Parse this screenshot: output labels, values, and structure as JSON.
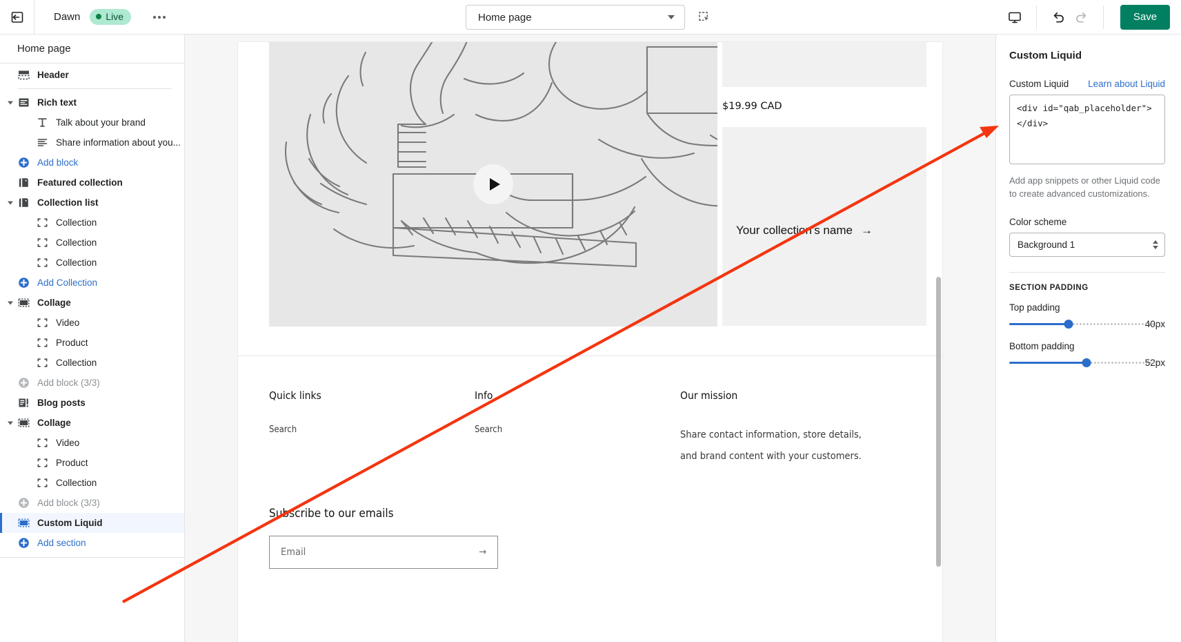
{
  "topbar": {
    "exit_icon": "exit-arrow-icon",
    "theme_name": "Dawn",
    "status_badge": "Live",
    "more_actions": "more-actions-icon",
    "page_selector_value": "Home page",
    "inspect_icon": "select-inspect-icon",
    "device_icon": "desktop-preview-icon",
    "undo_icon": "undo-icon",
    "redo_icon": "redo-icon",
    "save_label": "Save"
  },
  "sidebar": {
    "header": "Home page",
    "items": [
      {
        "label": "Header",
        "type": "section",
        "icon": "header-layout-icon",
        "collapsible": false,
        "divider_after": true
      },
      {
        "label": "Rich text",
        "type": "section",
        "icon": "rich-text-icon",
        "collapsible": true
      },
      {
        "label": "Talk about your brand",
        "type": "block",
        "icon": "heading-text-icon"
      },
      {
        "label": "Share information about you...",
        "type": "block",
        "icon": "paragraph-lines-icon"
      },
      {
        "label": "Add block",
        "type": "add",
        "icon": "add-circle-icon"
      },
      {
        "label": "Featured collection",
        "type": "section",
        "icon": "collection-tag-icon",
        "collapsible": false
      },
      {
        "label": "Collection list",
        "type": "section",
        "icon": "collection-tag-icon",
        "collapsible": true
      },
      {
        "label": "Collection",
        "type": "block",
        "icon": "placeholder-brackets-icon"
      },
      {
        "label": "Collection",
        "type": "block",
        "icon": "placeholder-brackets-icon"
      },
      {
        "label": "Collection",
        "type": "block",
        "icon": "placeholder-brackets-icon"
      },
      {
        "label": "Add Collection",
        "type": "add",
        "icon": "add-circle-icon"
      },
      {
        "label": "Collage",
        "type": "section",
        "icon": "collage-layout-icon",
        "collapsible": true
      },
      {
        "label": "Video",
        "type": "block",
        "icon": "placeholder-brackets-icon"
      },
      {
        "label": "Product",
        "type": "block",
        "icon": "placeholder-brackets-icon"
      },
      {
        "label": "Collection",
        "type": "block",
        "icon": "placeholder-brackets-icon"
      },
      {
        "label": "Add block (3/3)",
        "type": "add-disabled",
        "icon": "add-circle-icon"
      },
      {
        "label": "Blog posts",
        "type": "section",
        "icon": "blog-posts-icon",
        "collapsible": false
      },
      {
        "label": "Collage",
        "type": "section",
        "icon": "collage-layout-icon",
        "collapsible": true
      },
      {
        "label": "Video",
        "type": "block",
        "icon": "placeholder-brackets-icon"
      },
      {
        "label": "Product",
        "type": "block",
        "icon": "placeholder-brackets-icon"
      },
      {
        "label": "Collection",
        "type": "block",
        "icon": "placeholder-brackets-icon"
      },
      {
        "label": "Add block (3/3)",
        "type": "add-disabled",
        "icon": "add-circle-icon"
      },
      {
        "label": "Custom Liquid",
        "type": "section",
        "icon": "collage-layout-icon",
        "collapsible": false,
        "selected": true
      },
      {
        "label": "Add section",
        "type": "add",
        "icon": "add-circle-icon"
      }
    ]
  },
  "preview": {
    "play_button": "play-video-button",
    "price": "$19.99 CAD",
    "collection_name": "Your collection's name",
    "collection_arrow": "→",
    "footer": {
      "columns": [
        {
          "title": "Quick links",
          "link": "Search"
        },
        {
          "title": "Info",
          "link": "Search"
        },
        {
          "title": "Our mission",
          "text_line1": "Share contact information, store details,",
          "text_line2": "and brand content with your customers."
        }
      ],
      "subscribe_title": "Subscribe to our emails",
      "email_placeholder": "Email",
      "email_submit_icon": "arrow-right-icon"
    }
  },
  "panel": {
    "title": "Custom Liquid",
    "field_label": "Custom Liquid",
    "learn_link": "Learn about Liquid",
    "code_value": "<div id=\"qab_placeholder\">\n</div>",
    "help_text": "Add app snippets or other Liquid code to create advanced customizations.",
    "color_scheme_label": "Color scheme",
    "color_scheme_value": "Background 1",
    "section_padding_heading": "Section padding",
    "top_padding_label": "Top padding",
    "top_padding_value": "40px",
    "top_padding_percent": 40,
    "bottom_padding_label": "Bottom padding",
    "bottom_padding_value": "52px",
    "bottom_padding_percent": 52
  },
  "colors": {
    "accent_blue": "#2c6ecb",
    "save_green": "#008060",
    "live_badge_bg": "#aee9d1",
    "live_badge_text": "#0c5132",
    "selected_row_bg": "#f2f6fe",
    "annotation_red": "#f4350f"
  },
  "annotation": {
    "name": "red-arrow-pointer",
    "color": "#f4350f"
  }
}
